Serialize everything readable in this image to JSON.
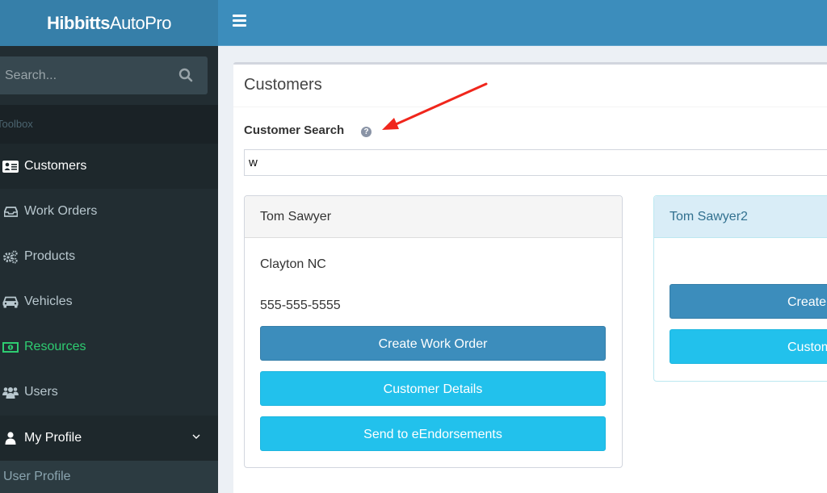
{
  "app": {
    "logo_bold": "Hibbitts",
    "logo_light": "AutoPro"
  },
  "sidebar": {
    "search_placeholder": "Search...",
    "section_header": "Toolbox",
    "items": [
      {
        "label": "Customers",
        "icon": "address-card-icon",
        "state": "active"
      },
      {
        "label": "Work Orders",
        "icon": "inbox-icon",
        "state": "normal"
      },
      {
        "label": "Products",
        "icon": "cogs-icon",
        "state": "normal"
      },
      {
        "label": "Vehicles",
        "icon": "car-icon",
        "state": "normal"
      },
      {
        "label": "Resources",
        "icon": "money-bill-icon",
        "state": "highlight"
      },
      {
        "label": "Users",
        "icon": "users-icon",
        "state": "normal"
      },
      {
        "label": "My Profile",
        "icon": "user-icon",
        "state": "expanded"
      }
    ],
    "submenu": [
      {
        "label": "User Profile"
      }
    ]
  },
  "main": {
    "page_title": "Customers",
    "search_label": "Customer Search",
    "search_value": "w",
    "cards": [
      {
        "name": "Tom Sawyer",
        "location": "Clayton NC",
        "phone": "555-555-5555",
        "buttons": [
          "Create Work Order",
          "Customer Details",
          "Send to eEndorsements"
        ]
      },
      {
        "name": "Tom Sawyer2",
        "location": "",
        "phone": "",
        "buttons": [
          "Create Work Order",
          "Customer Details"
        ]
      }
    ]
  },
  "colors": {
    "header": "#3c8dbc",
    "logo_bg": "#367fa9",
    "sidebar_bg": "#222d32",
    "primary_button": "#3c8dbc",
    "info_button": "#22c1ec",
    "resources_green": "#2ecc71",
    "annotation_arrow": "#f0261c"
  }
}
